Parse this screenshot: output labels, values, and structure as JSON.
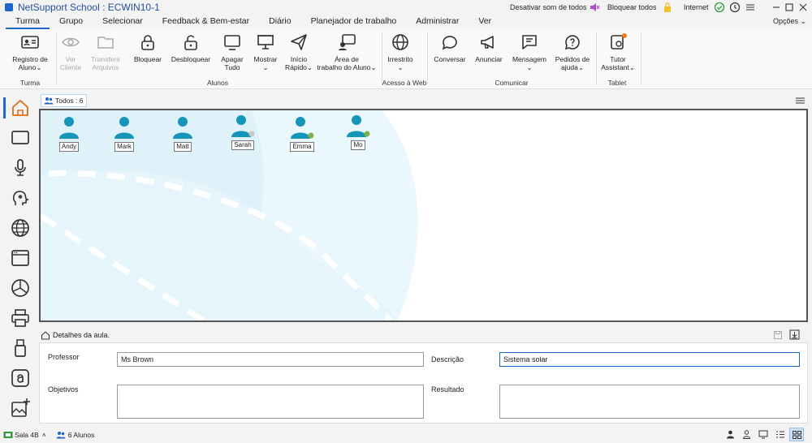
{
  "titlebar": {
    "title": "NetSupport School : ECWIN10-1",
    "mute_all_label": "Desativar som de todos",
    "lock_all_label": "Bloquear todos",
    "internet_label": "Internet"
  },
  "menubar": {
    "tabs": [
      "Turma",
      "Grupo",
      "Selecionar",
      "Feedback & Bem-estar",
      "Diário",
      "Planejador de trabalho",
      "Administrar",
      "Ver"
    ],
    "active_tab": "Turma",
    "options_label": "Opções"
  },
  "ribbon": {
    "student_register": [
      "Registro de",
      "Aluno"
    ],
    "view_client": [
      "Ver",
      "Cliente"
    ],
    "transfer_files": [
      "Transferir",
      "Arquivos"
    ],
    "lock": "Bloquear",
    "unlock": "Desbloquear",
    "blank_all": [
      "Apagar",
      "Tudo"
    ],
    "show": "Mostrar",
    "quick_launch": [
      "Início",
      "Rápido"
    ],
    "student_desktop": [
      "Área de",
      "trabalho do Aluno"
    ],
    "unrestricted": "Irrestrito",
    "chat": "Conversar",
    "announce": "Anunciar",
    "message": "Mensagem",
    "help_requests": [
      "Pedidos de",
      "ajuda"
    ],
    "tutor_assistant": [
      "Tutor",
      "Assistant"
    ],
    "groups": {
      "class": "Turma",
      "students": "Alunos",
      "web_access": "Acesso à Web",
      "communicate": "Comunicar",
      "tablet": "Tablet"
    }
  },
  "view": {
    "all_label": "Todos : 6"
  },
  "students": [
    {
      "name": "Andy",
      "badge": "none"
    },
    {
      "name": "Mark",
      "badge": "none"
    },
    {
      "name": "Matt",
      "badge": "none"
    },
    {
      "name": "Sarah",
      "badge": "apple"
    },
    {
      "name": "Emma",
      "badge": "android"
    },
    {
      "name": "Mo",
      "badge": "android"
    }
  ],
  "lesson": {
    "header": "Detalhes da aula.",
    "teacher_label": "Professor",
    "teacher_value": "Ms Brown",
    "description_label": "Descrição",
    "description_value": "Sistema solar",
    "objectives_label": "Objetivos",
    "objectives_value": "",
    "result_label": "Resultado",
    "result_value": ""
  },
  "statusbar": {
    "room": "Sala 4B",
    "students_count": "6 Alunos"
  },
  "colors": {
    "accent": "#1e66c8",
    "student_icon": "#1596b8",
    "android_badge": "#7cb342",
    "classroom_bg": "#eaf6fb"
  }
}
